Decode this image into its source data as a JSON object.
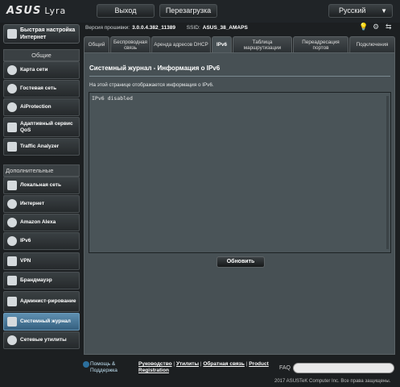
{
  "header": {
    "brand": "ASUS",
    "model": "Lyra",
    "logout_label": "Выход",
    "reboot_label": "Перезагрузка",
    "language": "Русский"
  },
  "firmware": {
    "label": "Версия прошивки:",
    "version": "3.0.0.4.382_11389",
    "ssid_label": "SSID:",
    "ssid": "ASUS_38_AMAPS"
  },
  "sidebar": {
    "quick_setup": "Быстрая настройка Интернет",
    "general_header": "Общие",
    "general_items": [
      {
        "label": "Карта сети"
      },
      {
        "label": "Гостевая сеть"
      },
      {
        "label": "AiProtection"
      },
      {
        "label": "Адаптивный сервис QoS"
      },
      {
        "label": "Traffic Analyzer"
      }
    ],
    "advanced_header": "Дополнительные настройки",
    "advanced_items": [
      {
        "label": "Локальная сеть"
      },
      {
        "label": "Интернет"
      },
      {
        "label": "Amazon Alexa"
      },
      {
        "label": "IPv6"
      },
      {
        "label": "VPN"
      },
      {
        "label": "Брандмауэр"
      },
      {
        "label": "Админист-рирование"
      },
      {
        "label": "Системный журнал"
      },
      {
        "label": "Сетевые утилиты"
      }
    ]
  },
  "tabs": [
    {
      "label": "Общий"
    },
    {
      "label": "Беспроводная связь"
    },
    {
      "label": "Аренда адресов DHCP"
    },
    {
      "label": "IPv6"
    },
    {
      "label": "Таблица маршрутизации"
    },
    {
      "label": "Переадресация портов"
    },
    {
      "label": "Подключения"
    }
  ],
  "main": {
    "title": "Системный журнал - Информация о IPv6",
    "description": "На этой странице отображается информация о IPv6.",
    "log_text": "IPv6 disabled",
    "refresh_label": "Обновить"
  },
  "footer": {
    "help_line1": "Помощь &",
    "help_line2": "Поддержка",
    "manual": "Руководство",
    "utilities": "Утилиты",
    "feedback": "Обратная связь",
    "product_line1": "Product",
    "product_line2": "Registration",
    "sep": "|",
    "faq_label": "FAQ",
    "copyright": "2017 ASUSTeK Computer Inc. Все права защищены."
  }
}
